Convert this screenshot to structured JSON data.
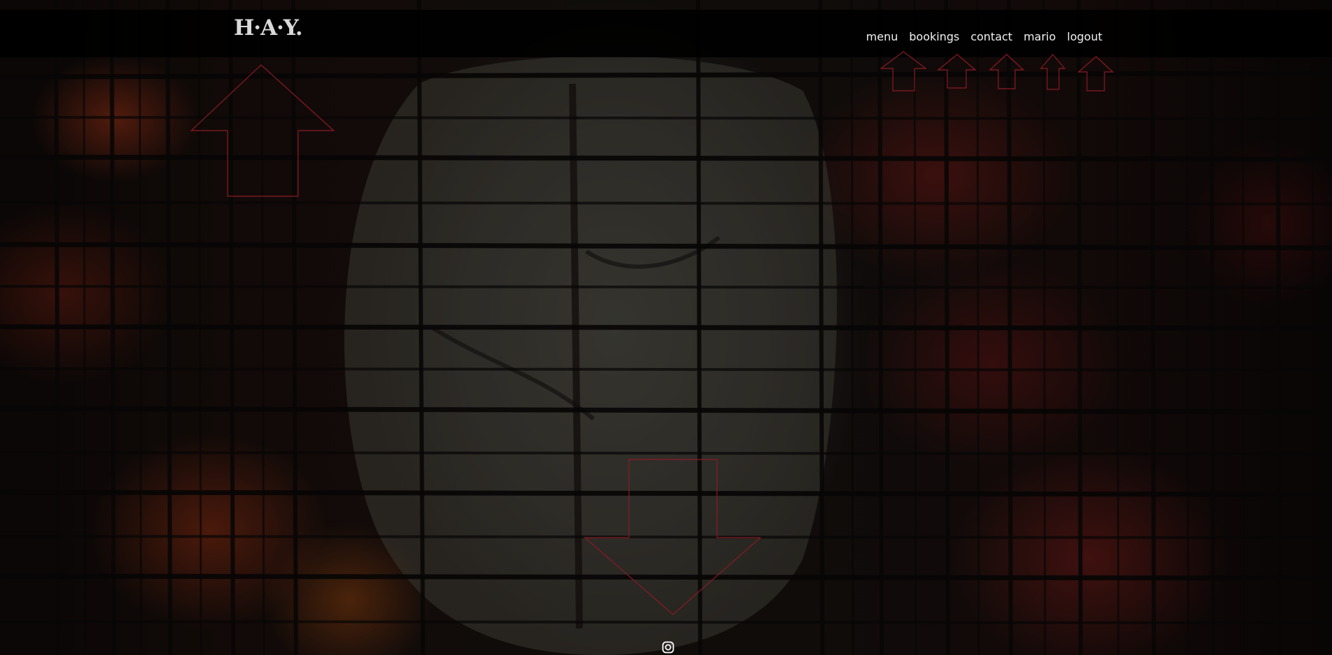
{
  "logo": {
    "text": "H·A·Y."
  },
  "nav": {
    "menu": "menu",
    "bookings": "bookings",
    "contact": "contact",
    "mario": "mario",
    "logout": "logout"
  },
  "colors": {
    "header_bg": "#000000",
    "nav_text": "#f2f2f2",
    "logo_text": "#d9d9d9",
    "arrow_stroke": "#8c1a24"
  },
  "icons": {
    "social": "instagram-icon",
    "scroll": "scroll-down-arrow-icon",
    "logo_pointer": "up-arrow-icon",
    "nav_pointer": "up-arrow-icon"
  }
}
